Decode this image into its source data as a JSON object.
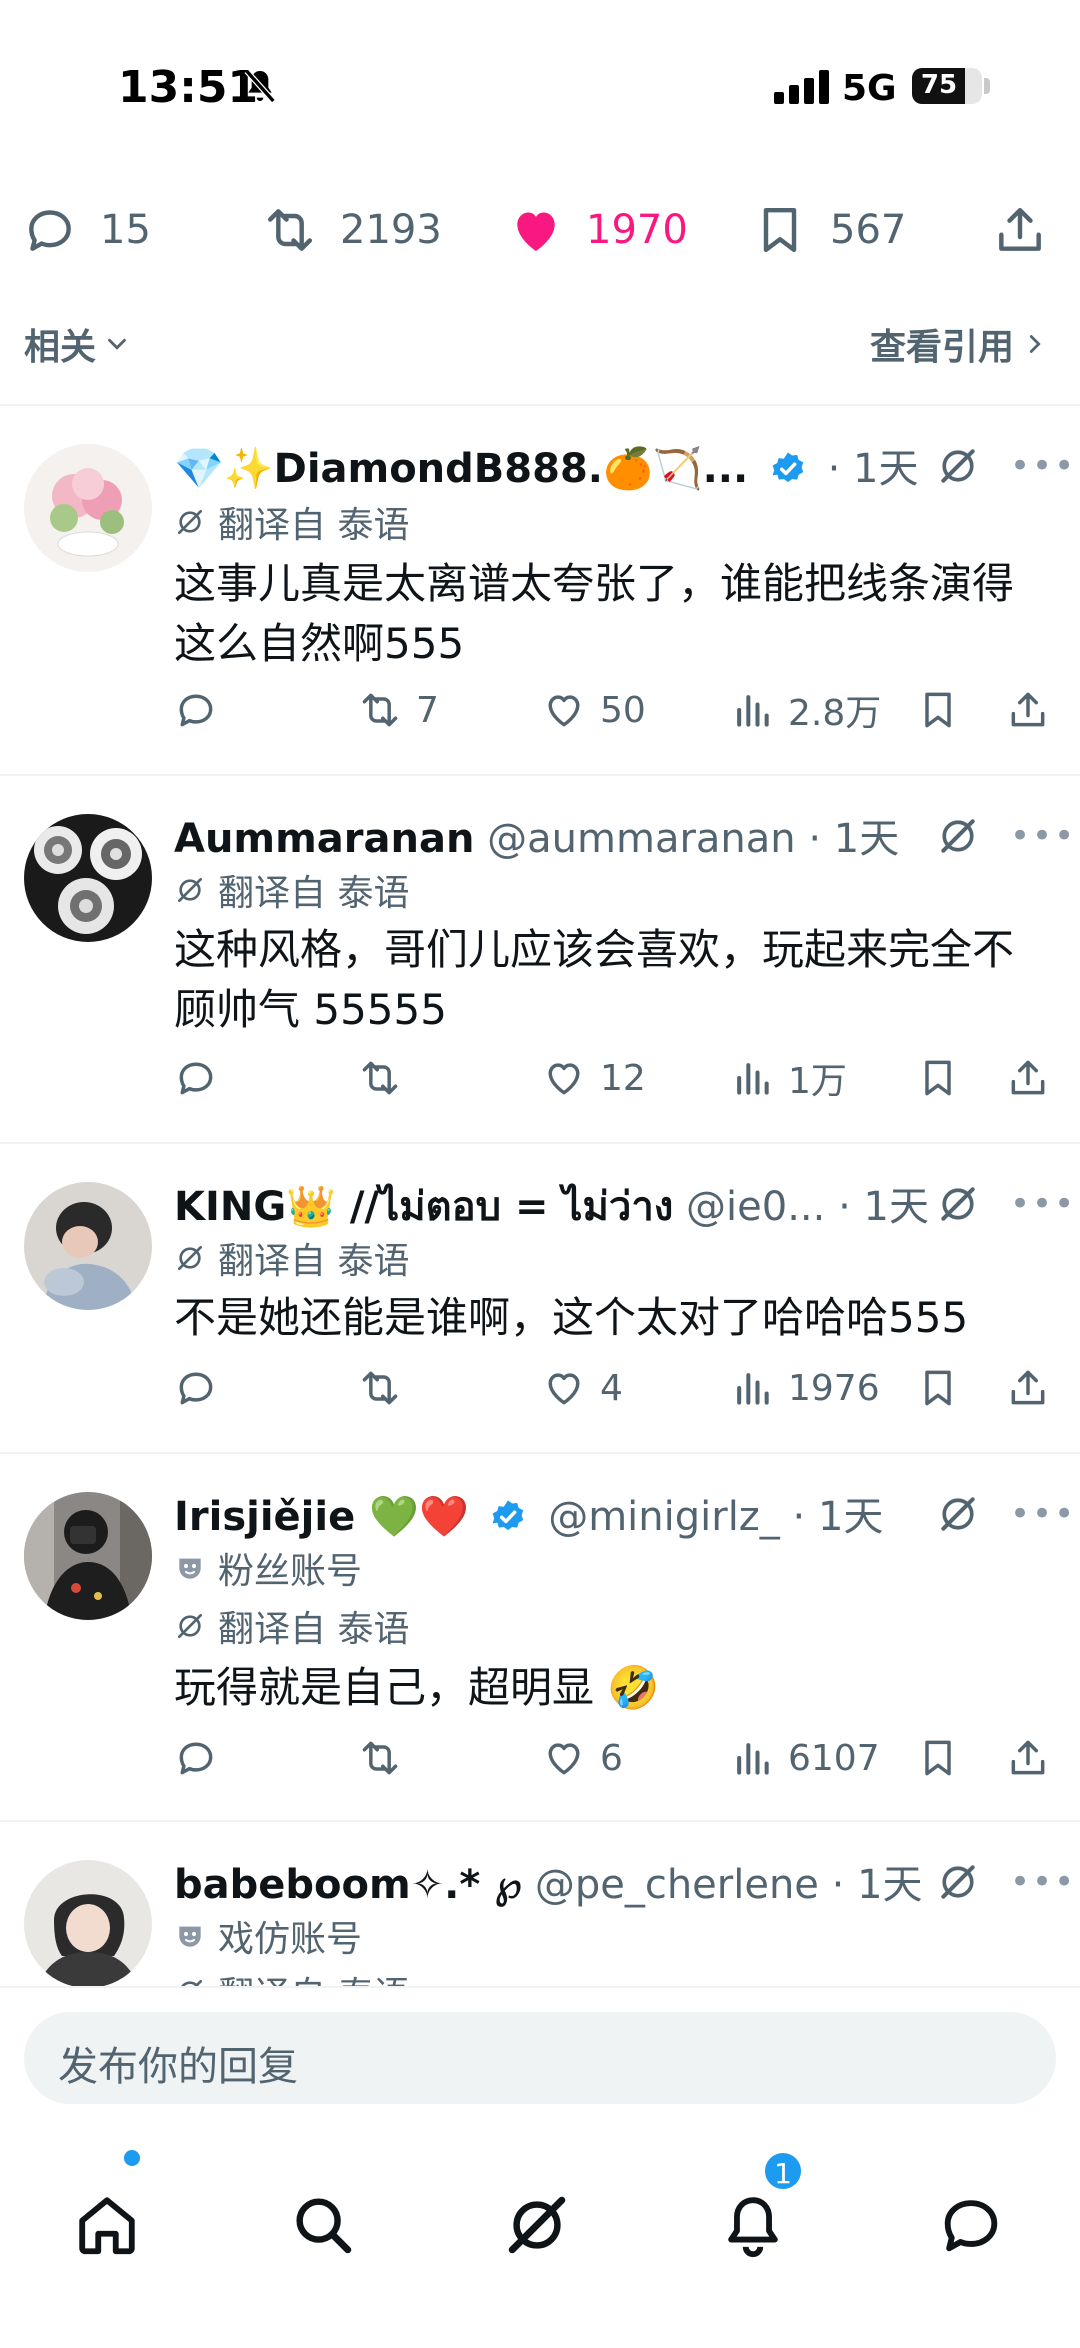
{
  "status_bar": {
    "time": "13:51",
    "network": "5G",
    "battery": "75",
    "battery_level": 0.75
  },
  "main_tweet": {
    "actions": {
      "replies": "15",
      "reposts": "2193",
      "likes": "1970",
      "bookmarks": "567"
    },
    "liked": true
  },
  "related": {
    "left_label": "相关",
    "right_label": "查看引用"
  },
  "replies": [
    {
      "name": "💎✨DiamondB888.🍊🏹...",
      "handle": "",
      "time": "· 1天",
      "verified": true,
      "translated": "翻译自 泰语",
      "text": "这事儿真是太离谱太夸张了，谁能把线条演得这么自然啊555",
      "stats": {
        "replies": "",
        "reposts": "7",
        "likes": "50",
        "views": "2.8万"
      }
    },
    {
      "name": "Aummaranan",
      "handle": "@aummaranan",
      "time": "· 1天",
      "verified": false,
      "translated": "翻译自 泰语",
      "text": "这种风格，哥们儿应该会喜欢，玩起来完全不顾帅气 55555",
      "stats": {
        "replies": "",
        "reposts": "",
        "likes": "12",
        "views": "1万"
      }
    },
    {
      "name": "KING👑 //ไม่ตอบ = ไม่ว่าง",
      "handle": "@ie0...",
      "time": "· 1天",
      "verified": false,
      "translated": "翻译自 泰语",
      "text": "不是她还能是谁啊，这个太对了哈哈哈555",
      "stats": {
        "replies": "",
        "reposts": "",
        "likes": "4",
        "views": "1976"
      }
    },
    {
      "name": "Irisjiějie 💚❤️",
      "handle": "@minigirlz_",
      "time": "· 1天",
      "verified": true,
      "account_label": "粉丝账号",
      "translated": "翻译自 泰语",
      "text": "玩得就是自己，超明显 🤣",
      "stats": {
        "replies": "",
        "reposts": "",
        "likes": "6",
        "views": "6107"
      }
    },
    {
      "name": "babeboom✧.* ℘",
      "handle": "@pe_cherlene",
      "time": "· 1天",
      "verified": false,
      "account_label": "戏仿账号",
      "translated": "翻译自 泰语"
    }
  ],
  "reply_input": {
    "placeholder": "发布你的回复"
  },
  "nav": {
    "notifications_badge": "1"
  },
  "colors": {
    "like": "#f91880",
    "accent": "#1d9bf0",
    "muted": "#536471"
  }
}
